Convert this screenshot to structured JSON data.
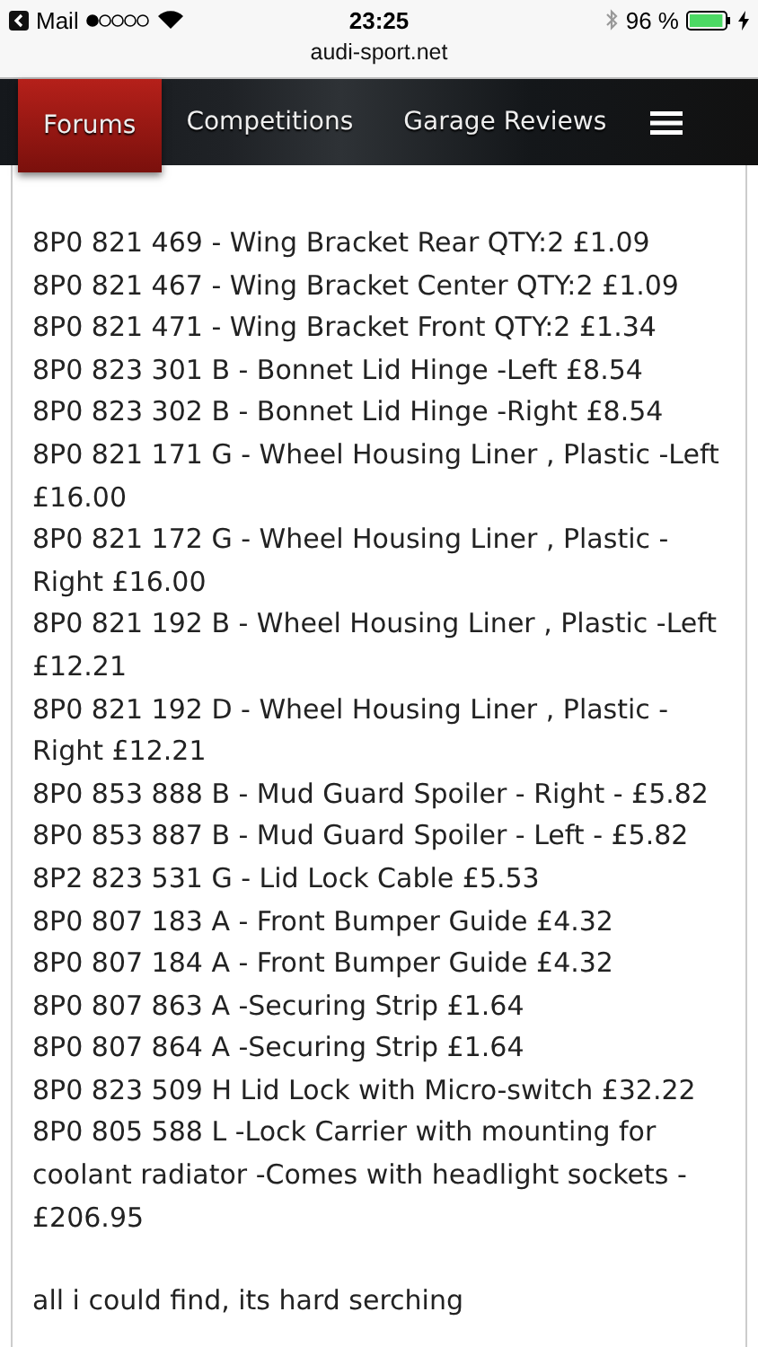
{
  "status_bar": {
    "back_app": "Mail",
    "time": "23:25",
    "battery": "96 %"
  },
  "url": "audi-sport.net",
  "nav": {
    "tabs": [
      {
        "label": "Forums",
        "selected": true
      },
      {
        "label": "Competitions",
        "selected": false
      },
      {
        "label": "Garage Reviews",
        "selected": false
      }
    ]
  },
  "post": {
    "parts": [
      "8P0 821 469 - Wing Bracket Rear QTY:2 £1.09",
      "8P0 821 467 - Wing Bracket Center QTY:2 £1.09",
      "8P0 821 471 - Wing Bracket Front QTY:2 £1.34",
      "8P0 823 301 B - Bonnet Lid Hinge -Left £8.54",
      "8P0 823 302 B - Bonnet Lid Hinge -Right £8.54",
      "8P0 821 171 G - Wheel Housing Liner , Plastic -Left £16.00",
      "8P0 821 172 G - Wheel Housing Liner , Plastic -Right £16.00",
      "8P0 821 192 B - Wheel Housing Liner , Plastic -Left £12.21",
      "8P0 821 192 D - Wheel Housing Liner , Plastic -Right £12.21",
      "8P0 853 888 B - Mud Guard Spoiler - Right - £5.82",
      "8P0 853 887 B - Mud Guard Spoiler - Left - £5.82",
      "8P2 823 531 G - Lid Lock Cable £5.53",
      "8P0 807 183 A - Front Bumper Guide £4.32",
      "8P0 807 184 A - Front Bumper Guide £4.32",
      "8P0 807 863 A -Securing Strip £1.64",
      "8P0 807 864 A -Securing Strip £1.64",
      "8P0 823 509 H Lid Lock with Micro-switch £32.22",
      "8P0 805 588 L -Lock Carrier with mounting for coolant radiator -Comes with headlight sockets - £206.95"
    ],
    "closing": "all i could find, its hard serching"
  }
}
